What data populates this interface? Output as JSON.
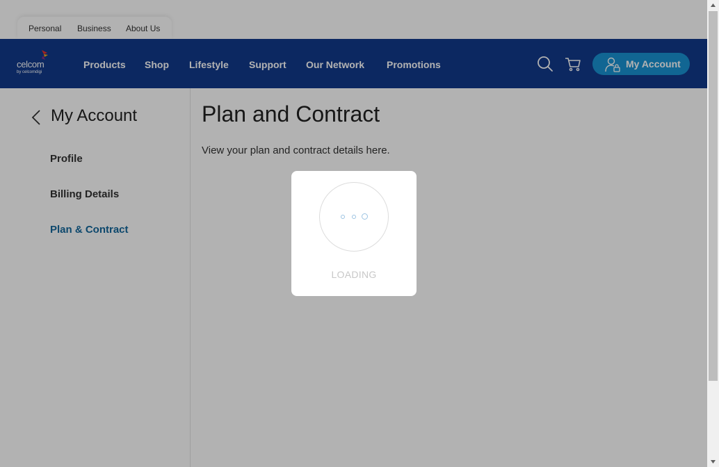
{
  "top_tabs": [
    "Personal",
    "Business",
    "About Us"
  ],
  "brand": {
    "name": "celcom",
    "sub": "by celcomdigi"
  },
  "nav": {
    "items": [
      "Products",
      "Shop",
      "Lifestyle",
      "Support",
      "Our Network",
      "Promotions"
    ],
    "search_icon": "search-icon",
    "cart_icon": "cart-icon",
    "account_label": "My Account"
  },
  "sidebar": {
    "title": "My Account",
    "items": [
      {
        "label": "Profile",
        "active": false
      },
      {
        "label": "Billing Details",
        "active": false
      },
      {
        "label": "Plan & Contract",
        "active": true
      }
    ]
  },
  "main": {
    "title": "Plan and Contract",
    "subtitle": "View your plan and contract details here."
  },
  "loader": {
    "text": "LOADING"
  },
  "colors": {
    "nav_bg": "#123a8c",
    "account_btn": "#1993d3",
    "active_link": "#14689c"
  }
}
